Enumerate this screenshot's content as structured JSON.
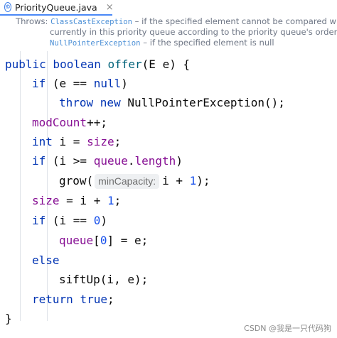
{
  "tab": {
    "icon_letter": "©",
    "title": "PriorityQueue.java",
    "close": "×"
  },
  "doc": {
    "line1_prefix": "Throws: ",
    "line1_code": "ClassCastException",
    "line1_text": " – if the specified element cannot be compared with elements",
    "line2_text": "currently in this priority queue according to the priority queue's ordering",
    "line3_code": "NullPointerException",
    "line3_text": " – if the specified element is null"
  },
  "code": {
    "l1": {
      "a": "public boolean ",
      "b": "offer",
      "c": "(E e) {"
    },
    "l2": {
      "a": "if",
      "b": " (e == ",
      "c": "null",
      "d": ")"
    },
    "l3": {
      "a": "throw new ",
      "b": "NullPointerException();"
    },
    "l4": {
      "a": "modCount",
      "b": "++;"
    },
    "l5": {
      "a": "int",
      "b": " i = ",
      "c": "size",
      "d": ";"
    },
    "l6": {
      "a": "if",
      "b": " (i >= ",
      "c": "queue",
      "d": ".",
      "e": "length",
      "f": ")"
    },
    "l7": {
      "a": "grow(",
      "hint": "minCapacity:",
      "b": "i + ",
      "c": "1",
      "d": ");"
    },
    "l8": {
      "a": "size",
      "b": " = i + ",
      "c": "1",
      "d": ";"
    },
    "l9": {
      "a": "if",
      "b": " (i == ",
      "c": "0",
      "d": ")"
    },
    "l10": {
      "a": "queue",
      "b": "[",
      "c": "0",
      "d": "] = e;"
    },
    "l11": {
      "a": "else"
    },
    "l12": {
      "a": "siftUp(i, e);"
    },
    "l13": {
      "a": "return ",
      "b": "true",
      "c": ";"
    },
    "l14": {
      "a": "}"
    }
  },
  "watermark": "CSDN @我是一只代码狗"
}
